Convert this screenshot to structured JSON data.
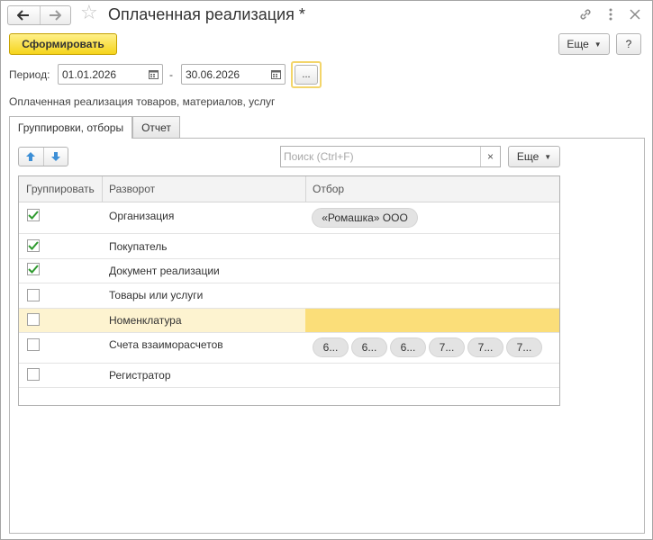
{
  "window": {
    "title": "Оплаченная реализация *"
  },
  "toolbar": {
    "generate_label": "Сформировать",
    "more_label": "Еще",
    "help_label": "?"
  },
  "period": {
    "label": "Период:",
    "from": "01.01.2026",
    "separator": "-",
    "to": "30.06.2026",
    "choose_label": "..."
  },
  "description": "Оплаченная реализация товаров, материалов, услуг",
  "tabs": [
    {
      "label": "Группировки, отборы",
      "active": true
    },
    {
      "label": "Отчет",
      "active": false
    }
  ],
  "search": {
    "placeholder": "Поиск (Ctrl+F)",
    "clear_label": "×"
  },
  "panel_more_label": "Еще",
  "grid": {
    "columns": [
      "Группировать",
      "Разворот",
      "Отбор"
    ],
    "rows": [
      {
        "checked": true,
        "label": "Организация",
        "filters": [
          "«Ромашка» ООО"
        ]
      },
      {
        "checked": true,
        "label": "Покупатель",
        "filters": []
      },
      {
        "checked": true,
        "label": "Документ реализации",
        "filters": []
      },
      {
        "checked": false,
        "label": "Товары или услуги",
        "filters": []
      },
      {
        "checked": false,
        "label": "Номенклатура",
        "filters": [],
        "selected": true
      },
      {
        "checked": false,
        "label": "Счета взаиморасчетов",
        "filters": [
          "6...",
          "6...",
          "6...",
          "7...",
          "7...",
          "7..."
        ]
      },
      {
        "checked": false,
        "label": "Регистратор",
        "filters": []
      }
    ]
  },
  "colors": {
    "primary_button": "#f5d41c",
    "selected_row": "#fdf3d0",
    "selected_cell": "#fbde79",
    "check": "#2e9a2e",
    "arrow_icon": "#3d8fd6"
  }
}
